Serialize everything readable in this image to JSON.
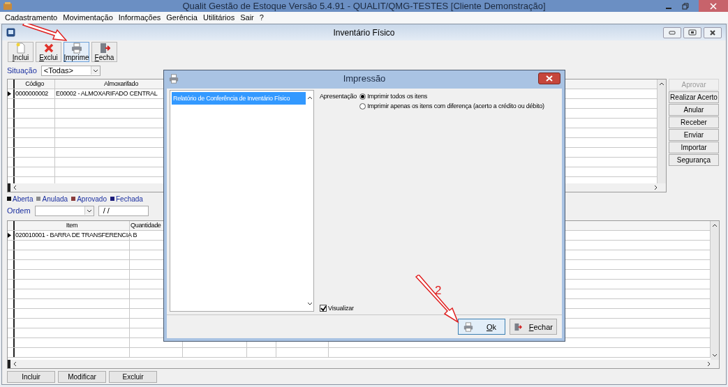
{
  "app_window": {
    "title": "Qualit Gestão de Estoque Versão 5.4.91 - QUALIT/QMG-TESTES [Cliente Demonstração]"
  },
  "menu": [
    "Cadastramento",
    "Movimentação",
    "Informações",
    "Gerência",
    "Utilitários",
    "Sair",
    "?"
  ],
  "child_window": {
    "title": "Inventário Físico"
  },
  "toolbar": [
    {
      "label": "Inclui",
      "kind": "new",
      "highlighted": false
    },
    {
      "label": "Exclui",
      "kind": "delete",
      "highlighted": false
    },
    {
      "label": "Imprime",
      "kind": "print",
      "highlighted": true
    },
    {
      "label": "Fecha",
      "kind": "close",
      "highlighted": false
    }
  ],
  "situacao": {
    "label": "Situação",
    "value": "<Todas>"
  },
  "grid_top": {
    "columns": [
      "Código",
      "Almoxarifado"
    ],
    "rows": [
      {
        "cells": [
          "0000000002",
          "E00002 - ALMOXARIFADO CENTRAL"
        ],
        "current": true
      }
    ]
  },
  "side_buttons": [
    {
      "label": "Aprovar",
      "disabled": true
    },
    {
      "label": "Realizar Acerto",
      "disabled": false
    },
    {
      "label": "Anular",
      "disabled": false
    },
    {
      "label": "Receber",
      "disabled": false
    },
    {
      "label": "Enviar",
      "disabled": false
    },
    {
      "label": "Importar",
      "disabled": false
    },
    {
      "label": "Segurança",
      "disabled": false
    }
  ],
  "legend": [
    {
      "label": "Aberta",
      "color": "#111111"
    },
    {
      "label": "Anulada",
      "color": "#8c8c8c"
    },
    {
      "label": "Aprovado",
      "color": "#8a3b3b"
    },
    {
      "label": "Fechada",
      "color": "#1c1c7a"
    }
  ],
  "ordem": {
    "label": "Ordem",
    "date_value": "/ /"
  },
  "grid_bottom": {
    "columns": [
      "Item",
      "Quantidade"
    ],
    "rows": [
      {
        "cells": [
          "020010001 - BARRA DE TRANSFERENCIA B"
        ],
        "current": true
      }
    ]
  },
  "bottom_buttons": [
    "Incluir",
    "Modificar",
    "Excluir"
  ],
  "dialog": {
    "title": "Impressão",
    "reports": [
      {
        "label": "Relatório de Conferência de Inventário Físico",
        "selected": true
      }
    ],
    "presentation_label": "Apresentação",
    "options": [
      {
        "label": "Imprimir todos os itens",
        "selected": true
      },
      {
        "label": "Imprimir apenas os itens com diferença (acerto a crédito ou débito)",
        "selected": false
      }
    ],
    "preview": {
      "label": "Visualizar",
      "checked": true
    },
    "buttons": [
      {
        "label": "Ok",
        "kind": "print",
        "focused": true
      },
      {
        "label": "Fechar",
        "kind": "close",
        "focused": false
      }
    ]
  },
  "callout": {
    "number": "2"
  }
}
